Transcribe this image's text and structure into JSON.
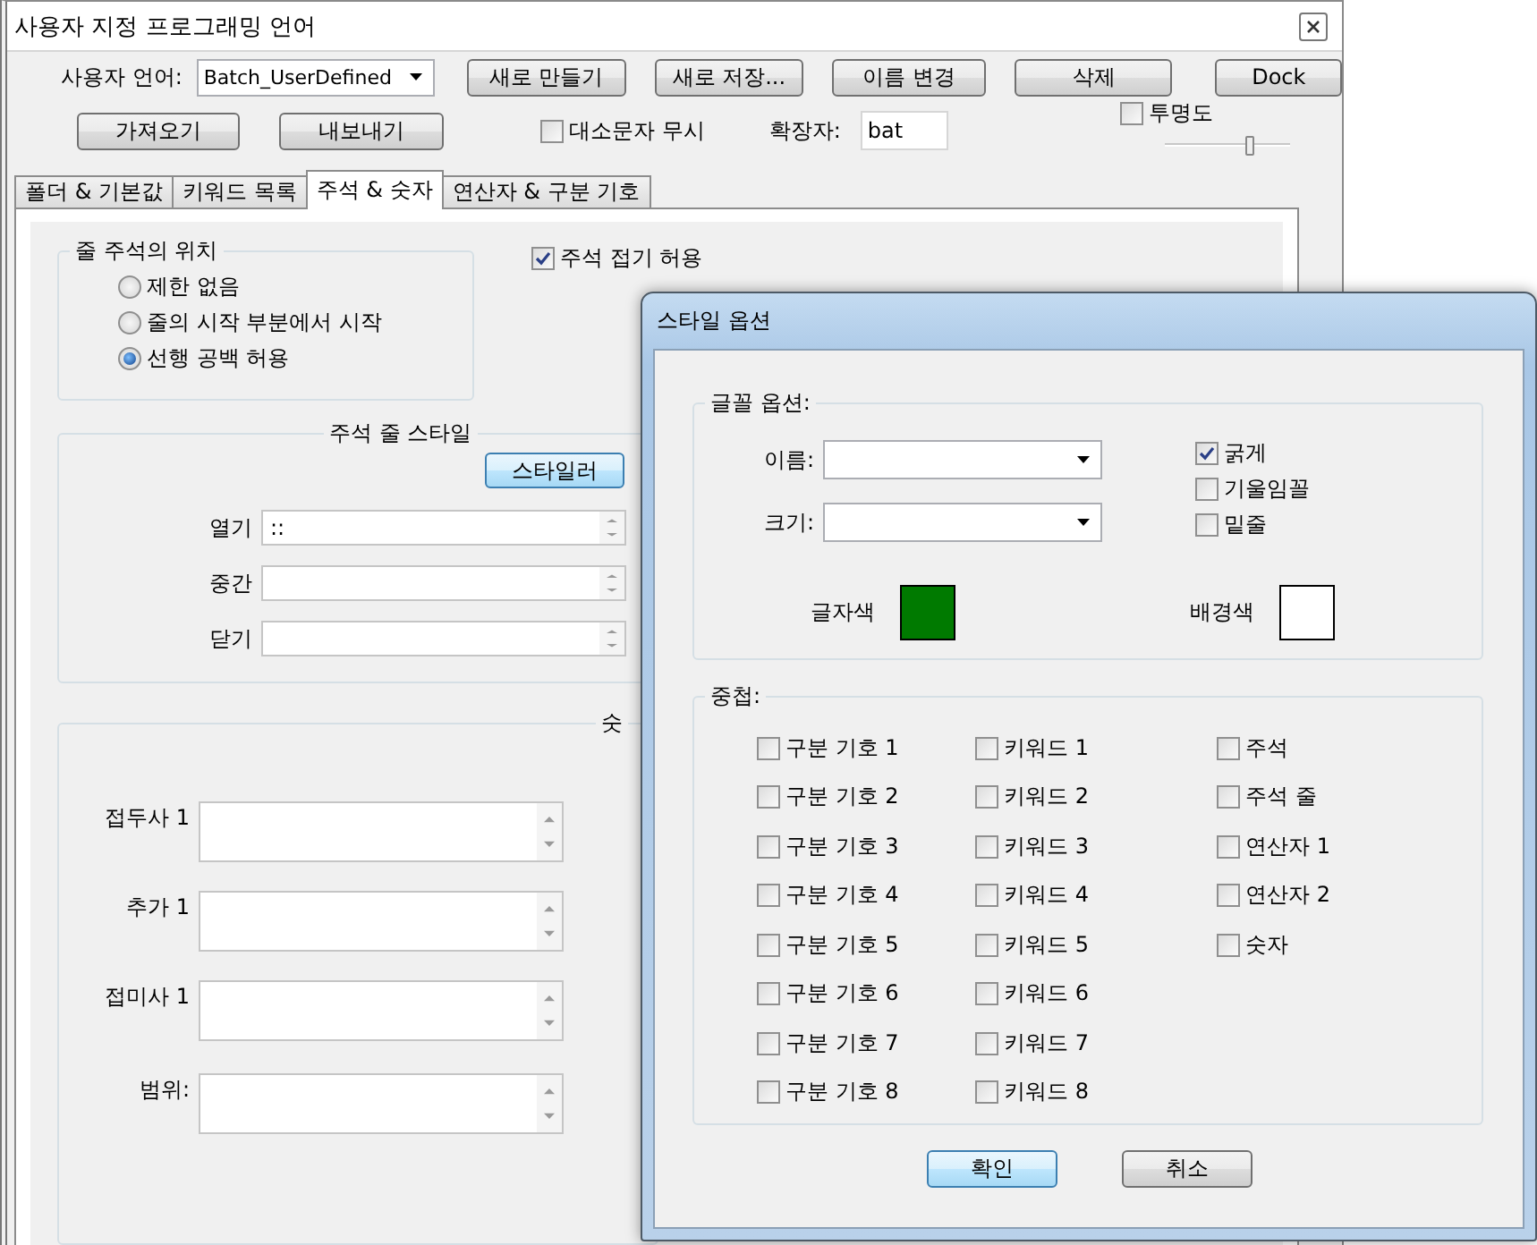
{
  "window": {
    "title": "사용자 지정 프로그래밍 언어"
  },
  "toolbar": {
    "language_label": "사용자 언어:",
    "language": "Batch_UserDefined",
    "buttons": [
      "새로 만들기",
      "새로 저장...",
      "이름 변경",
      "삭제",
      "Dock"
    ]
  },
  "options": {
    "import_button": "가져오기",
    "export_button": "내보내기",
    "ignore_case": {
      "label": "대소문자 무시",
      "checked": false
    },
    "extension_label": "확장자:",
    "extension": "bat",
    "transparency": {
      "label": "투명도",
      "checked": false,
      "level": 0.68
    }
  },
  "tabs": [
    {
      "label": "폴더 & 기본값",
      "selected": false
    },
    {
      "label": "키워드 목록",
      "selected": false
    },
    {
      "label": "주석 & 숫자",
      "selected": true
    },
    {
      "label": "연산자 & 구분 기호",
      "selected": false
    }
  ],
  "comment_position": {
    "title": "줄 주석의 위치",
    "options": [
      {
        "label": "제한 없음",
        "selected": false
      },
      {
        "label": "줄의 시작 부분에서 시작",
        "selected": false
      },
      {
        "label": "선행 공백 허용",
        "selected": true
      }
    ]
  },
  "allow_folding": {
    "label": "주석 접기 허용",
    "checked": true
  },
  "comment_style": {
    "title": "주석 줄 스타일",
    "styler_button": "스타일러",
    "fields": [
      {
        "label": "열기",
        "value": "::"
      },
      {
        "label": "중간"
      },
      {
        "label": "닫기"
      }
    ]
  },
  "numbers": {
    "title": "숫",
    "fields": [
      {
        "label": "접두사 1"
      },
      {
        "label": "추가 1"
      },
      {
        "label": "접미사 1"
      },
      {
        "label": "범위:"
      }
    ]
  },
  "dialog": {
    "title": "스타일 옵션",
    "font_group": {
      "title": "글꼴 옵션:",
      "name_label": "이름:",
      "size_label": "크기:",
      "styles": [
        {
          "label": "굵게",
          "checked": true
        },
        {
          "label": "기울임꼴",
          "checked": false
        },
        {
          "label": "밑줄",
          "checked": false
        }
      ],
      "swatches": [
        {
          "label": "글자색",
          "color": "#007a00"
        },
        {
          "label": "배경색",
          "color": "#ffffff"
        }
      ]
    },
    "nesting": {
      "title": "중첩:",
      "columns": [
        [
          {
            "label": "구분 기호 1",
            "checked": false
          },
          {
            "label": "구분 기호 2",
            "checked": false
          },
          {
            "label": "구분 기호 3",
            "checked": false
          },
          {
            "label": "구분 기호 4",
            "checked": false
          },
          {
            "label": "구분 기호 5",
            "checked": false
          },
          {
            "label": "구분 기호 6",
            "checked": false
          },
          {
            "label": "구분 기호 7",
            "checked": false
          },
          {
            "label": "구분 기호 8",
            "checked": false
          }
        ],
        [
          {
            "label": "키워드 1",
            "checked": false
          },
          {
            "label": "키워드 2",
            "checked": false
          },
          {
            "label": "키워드 3",
            "checked": false
          },
          {
            "label": "키워드 4",
            "checked": false
          },
          {
            "label": "키워드 5",
            "checked": false
          },
          {
            "label": "키워드 6",
            "checked": false
          },
          {
            "label": "키워드 7",
            "checked": false
          },
          {
            "label": "키워드 8",
            "checked": false
          }
        ],
        [
          {
            "label": "주석",
            "checked": false
          },
          {
            "label": "주석 줄",
            "checked": false
          },
          {
            "label": "연산자 1",
            "checked": false
          },
          {
            "label": "연산자 2",
            "checked": false
          },
          {
            "label": "숫자",
            "checked": false
          }
        ]
      ]
    },
    "buttons": [
      {
        "label": "확인",
        "default": true
      },
      {
        "label": "취소",
        "default": false
      }
    ]
  }
}
